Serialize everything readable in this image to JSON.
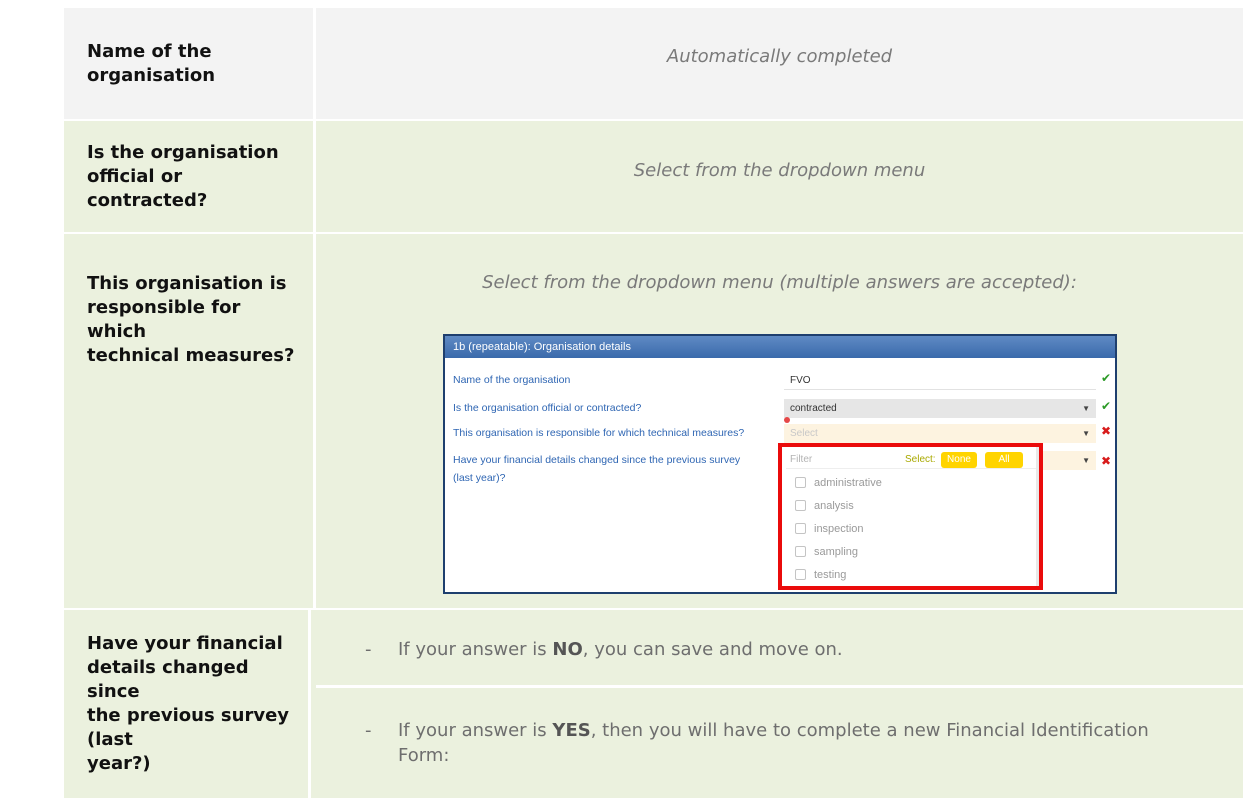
{
  "rows": {
    "name": {
      "label_lines": [
        "Name of the",
        "organisation"
      ],
      "value": "Automatically completed"
    },
    "official": {
      "label_lines": [
        "Is the organisation",
        "official or contracted?"
      ],
      "value": "Select from the dropdown menu"
    },
    "technical": {
      "label_lines": [
        "This organisation is",
        "responsible for which",
        "technical measures?"
      ],
      "value": "Select from the dropdown menu (multiple answers are accepted):"
    },
    "financial": {
      "label_lines": [
        "Have your financial",
        "details changed since",
        "the previous survey (last",
        "year?)"
      ],
      "no": {
        "dash": "-",
        "prefix": "If your answer is ",
        "keyword": "NO",
        "suffix": ", you can save and move on."
      },
      "yes": {
        "dash": "-",
        "prefix": "If your answer is ",
        "keyword": "YES",
        "suffix": ", then you will have to complete a new Financial Identification Form:"
      }
    }
  },
  "embedded_screenshot": {
    "header": "1b (repeatable): Organisation details",
    "questions": [
      "Name of the organisation",
      "Is the organisation official or contracted?",
      "This organisation is responsible for which technical measures?",
      "Have your financial details changed since the previous survey",
      "(last year)?"
    ],
    "fields": {
      "name_value": "FVO",
      "official_value": "contracted",
      "select_placeholder": "Select"
    },
    "dropdown": {
      "filter_placeholder": "Filter",
      "select_label": "Select:",
      "none_label": "None",
      "all_label": "All",
      "options": [
        "administrative",
        "analysis",
        "inspection",
        "sampling",
        "testing"
      ]
    },
    "colors": {
      "header": "#3a6aab",
      "highlight_border": "#ea0b0b",
      "ok": "#2b9a26",
      "error": "#d81b1b",
      "button": "#ffd400"
    }
  }
}
